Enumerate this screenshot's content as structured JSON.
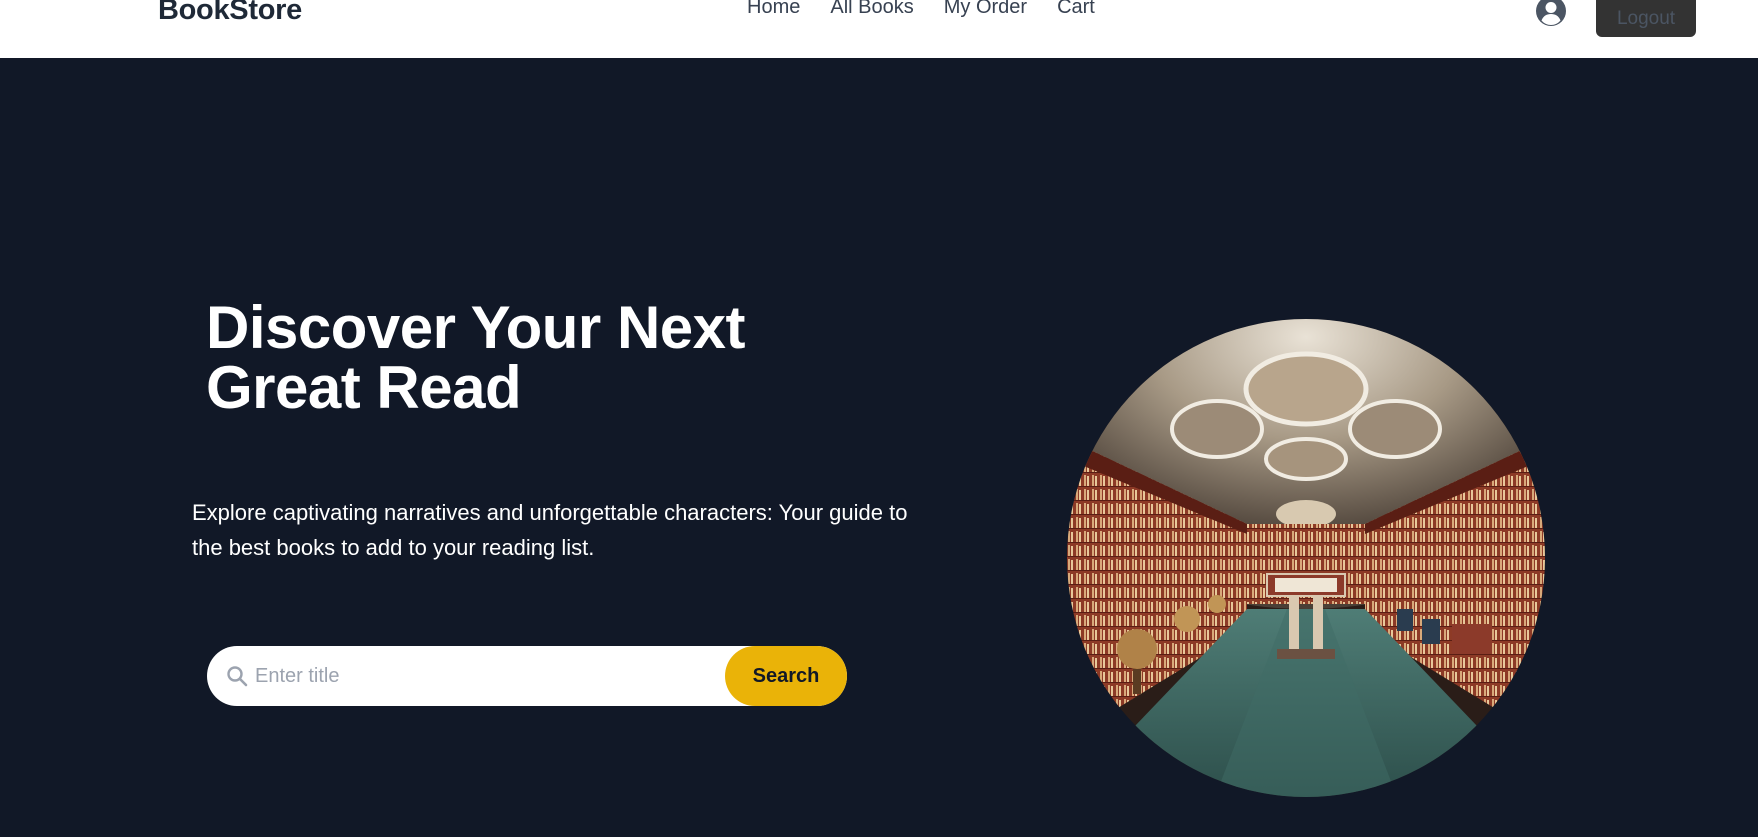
{
  "navbar": {
    "brand": "BookStore",
    "links": [
      "Home",
      "All Books",
      "My Order",
      "Cart"
    ],
    "logout_label": "Logout"
  },
  "hero": {
    "title_line1": "Discover Your Next",
    "title_line2": "Great Read",
    "subtitle": "Explore captivating narratives and unforgettable characters: Your guide to the best books to add to your reading list.",
    "search": {
      "placeholder": "Enter title",
      "value": "",
      "button_label": "Search"
    }
  },
  "colors": {
    "background": "#111827",
    "accent": "#eab308",
    "navbar": "#ffffff",
    "logout_bg": "#333333"
  },
  "icons": {
    "user": "user-circle-icon",
    "search": "search-icon"
  }
}
